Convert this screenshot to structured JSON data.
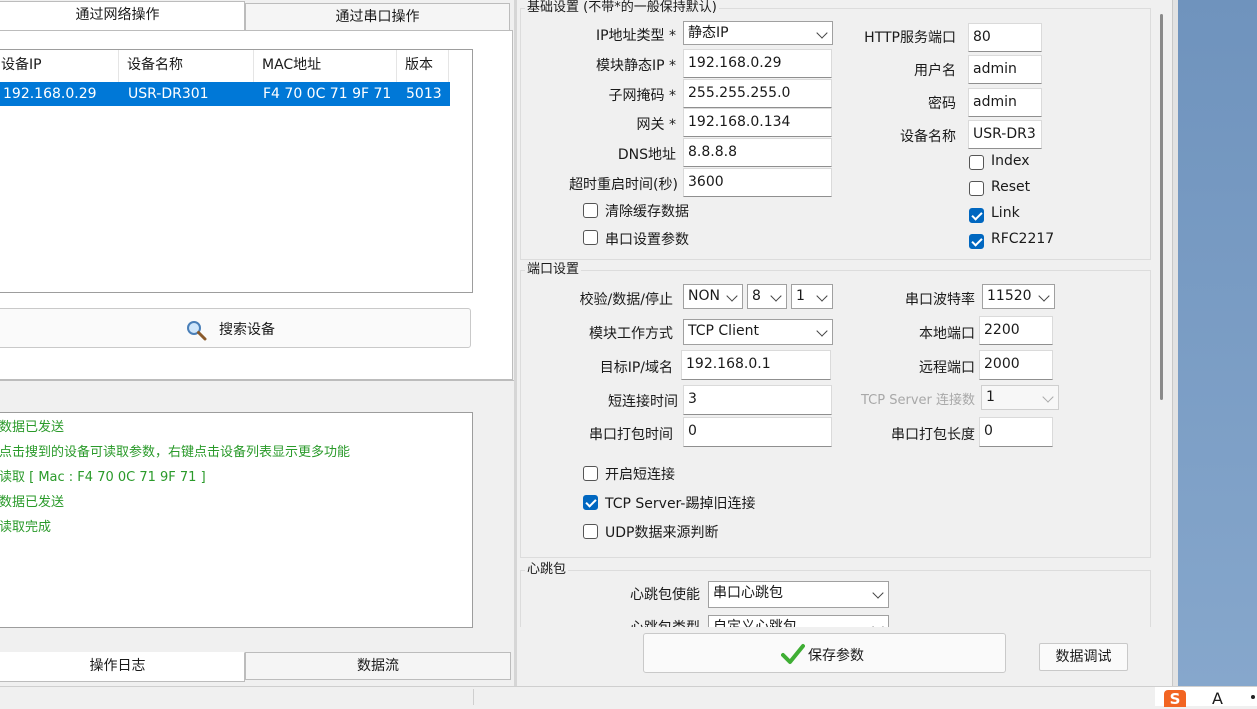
{
  "left": {
    "tabs": [
      "通过网络操作",
      "通过串口操作"
    ],
    "table": {
      "headers": [
        "设备IP",
        "设备名称",
        "MAC地址",
        "版本"
      ],
      "rows": [
        [
          "192.168.0.29",
          "USR-DR301",
          "F4 70 0C 71 9F 71",
          "5013"
        ]
      ]
    },
    "search_button": "搜索设备",
    "log_lines": [
      "数据已发送",
      "点击搜到的设备可读取参数，右键点击设备列表显示更多功能",
      "读取 [ Mac : F4 70 0C 71 9F 71 ]",
      "数据已发送",
      "读取完成"
    ],
    "bottom_tabs": [
      "操作日志",
      "数据流"
    ]
  },
  "basic": {
    "title": "基础设置 (不带*的一般保持默认)",
    "ip_type_label": "IP地址类型 *",
    "ip_type_value": "静态IP",
    "static_ip_label": "模块静态IP *",
    "static_ip_value": "192.168.0.29",
    "subnet_label": "子网掩码 *",
    "subnet_value": "255.255.255.0",
    "gateway_label": "网关 *",
    "gateway_value": "192.168.0.134",
    "dns_label": "DNS地址",
    "dns_value": "8.8.8.8",
    "timeout_label": "超时重启时间(秒)",
    "timeout_value": "3600",
    "clear_cache_label": "清除缓存数据",
    "clear_cache_checked": false,
    "serial_params_label": "串口设置参数",
    "serial_params_checked": false,
    "http_port_label": "HTTP服务端口",
    "http_port_value": "80",
    "username_label": "用户名",
    "username_value": "admin",
    "password_label": "密码",
    "password_value": "admin",
    "device_name_label": "设备名称",
    "device_name_value": "USR-DR3",
    "index_label": "Index",
    "index_checked": false,
    "reset_label": "Reset",
    "reset_checked": false,
    "link_label": "Link",
    "link_checked": true,
    "rfc_label": "RFC2217",
    "rfc_checked": true
  },
  "port": {
    "title": "端口设置",
    "parity_label": "校验/数据/停止",
    "parity_value": "NON",
    "data_bits_value": "8",
    "stop_bits_value": "1",
    "baud_label": "串口波特率",
    "baud_value": "11520",
    "mode_label": "模块工作方式",
    "mode_value": "TCP Client",
    "local_port_label": "本地端口",
    "local_port_value": "2200",
    "target_label": "目标IP/域名",
    "target_value": "192.168.0.1",
    "remote_port_label": "远程端口",
    "remote_port_value": "2000",
    "short_conn_time_label": "短连接时间",
    "short_conn_time_value": "3",
    "tcp_server_conn_label": "TCP Server 连接数",
    "tcp_server_conn_value": "1",
    "pack_time_label": "串口打包时间",
    "pack_time_value": "0",
    "pack_len_label": "串口打包长度",
    "pack_len_value": "0",
    "short_conn_label": "开启短连接",
    "short_conn_checked": false,
    "kick_old_label": "TCP Server-踢掉旧连接",
    "kick_old_checked": true,
    "udp_check_label": "UDP数据来源判断",
    "udp_check_checked": false
  },
  "heartbeat": {
    "title": "心跳包",
    "enable_label": "心跳包使能",
    "enable_value": "串口心跳包",
    "type_label": "心跳包类型",
    "type_value": "自定义心跳包"
  },
  "actions": {
    "save_label": "保存参数",
    "debug_label": "数据调试"
  },
  "taskbar": {
    "s_icon_text": "S",
    "a_text": "A"
  },
  "colors": {
    "selection": "#0078d7",
    "log_text": "#2a9a2a",
    "checkbox_on": "#0067c0",
    "desktop": "#7c9fc6"
  }
}
